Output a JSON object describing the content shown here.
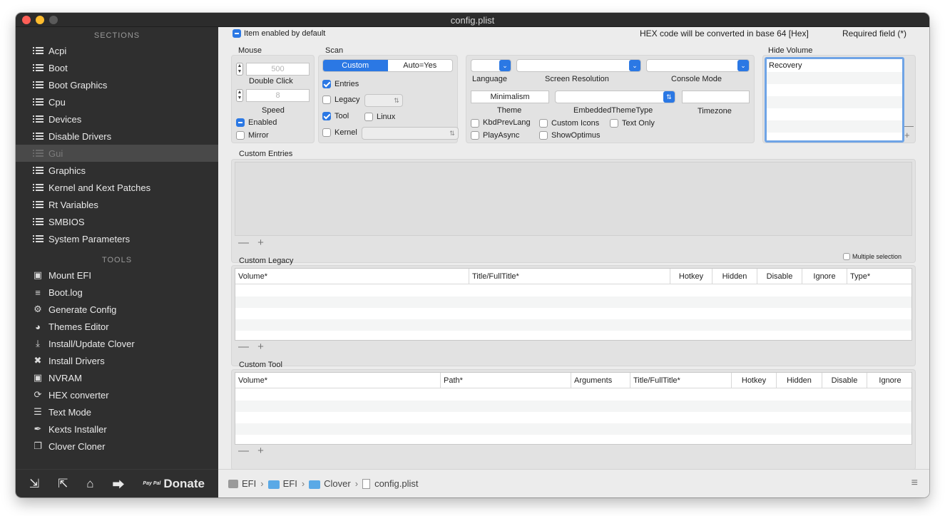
{
  "window": {
    "title": "config.plist"
  },
  "sidebar": {
    "sections_heading": "SECTIONS",
    "sections": [
      "Acpi",
      "Boot",
      "Boot Graphics",
      "Cpu",
      "Devices",
      "Disable Drivers",
      "Gui",
      "Graphics",
      "Kernel and Kext Patches",
      "Rt Variables",
      "SMBIOS",
      "System Parameters"
    ],
    "selected": "Gui",
    "tools_heading": "TOOLS",
    "tools": [
      {
        "label": "Mount EFI",
        "icon": "disk-icon"
      },
      {
        "label": "Boot.log",
        "icon": "log-search-icon"
      },
      {
        "label": "Generate Config",
        "icon": "gears-icon"
      },
      {
        "label": "Themes Editor",
        "icon": "palette-icon"
      },
      {
        "label": "Install/Update Clover",
        "icon": "download-icon"
      },
      {
        "label": "Install Drivers",
        "icon": "wrench-icon"
      },
      {
        "label": "NVRAM",
        "icon": "chip-icon"
      },
      {
        "label": "HEX converter",
        "icon": "refresh-icon"
      },
      {
        "label": "Text Mode",
        "icon": "text-lines-icon"
      },
      {
        "label": "Kexts Installer",
        "icon": "syringe-icon"
      },
      {
        "label": "Clover Cloner",
        "icon": "copy-icon"
      }
    ],
    "bottom": {
      "donate_label": "Donate",
      "paypal_small": "Pay Pal"
    }
  },
  "header": {
    "item_enabled_label": "Item enabled by default",
    "hex_note": "HEX code will be converted in base 64 [Hex]",
    "required_note": "Required field (*)"
  },
  "mouse": {
    "title": "Mouse",
    "double_click_value": "500",
    "double_click_label": "Double Click",
    "speed_value": "8",
    "speed_label": "Speed",
    "enabled_label": "Enabled",
    "mirror_label": "Mirror"
  },
  "scan": {
    "title": "Scan",
    "seg_custom": "Custom",
    "seg_auto": "Auto=Yes",
    "entries_label": "Entries",
    "legacy_label": "Legacy",
    "tool_label": "Tool",
    "linux_label": "Linux",
    "kernel_label": "Kernel"
  },
  "display": {
    "language_label": "Language",
    "screen_resolution_label": "Screen Resolution",
    "console_mode_label": "Console Mode",
    "theme_value": "Minimalism",
    "theme_label": "Theme",
    "embedded_theme_type_label": "EmbeddedThemeType",
    "timezone_label": "Timezone",
    "kbd_prev_lang_label": "KbdPrevLang",
    "custom_icons_label": "Custom Icons",
    "text_only_label": "Text Only",
    "play_async_label": "PlayAsync",
    "show_optimus_label": "ShowOptimus"
  },
  "hide_volume": {
    "title": "Hide Volume",
    "items": [
      "Recovery"
    ]
  },
  "custom_entries": {
    "title": "Custom Entries",
    "multiple_selection_label": "Multiple selection"
  },
  "custom_legacy": {
    "title": "Custom Legacy",
    "columns": [
      "Volume*",
      "Title/FullTitle*",
      "Hotkey",
      "Hidden",
      "Disable",
      "Ignore",
      "Type*"
    ]
  },
  "custom_tool": {
    "title": "Custom Tool",
    "columns": [
      "Volume*",
      "Path*",
      "Arguments",
      "Title/FullTitle*",
      "Hotkey",
      "Hidden",
      "Disable",
      "Ignore"
    ]
  },
  "breadcrumb": {
    "items": [
      "EFI",
      "EFI",
      "Clover",
      "config.plist"
    ]
  },
  "plus_minus": "— +",
  "colors": {
    "accent": "#2b78e4",
    "sidebar": "#2f2f2f",
    "sidebar_selected": "#494949"
  }
}
